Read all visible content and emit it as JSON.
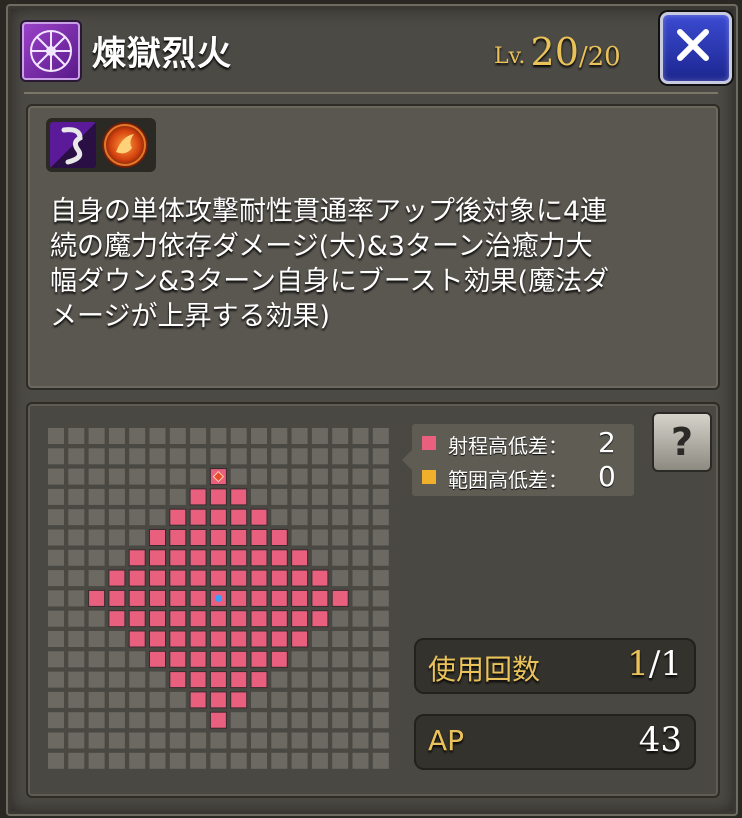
{
  "header": {
    "skill_icon": "magic-wheel-icon",
    "title": "煉獄烈火",
    "level_prefix": "Lv.",
    "level_current": "20",
    "level_separator": "/",
    "level_max": "20",
    "close_icon": "close-x-icon"
  },
  "description": {
    "effect_icons": [
      "dark-slash-icon",
      "fire-orb-icon"
    ],
    "lines": [
      "自身の単体攻撃耐性貫通率アップ後対象に4連",
      "続の魔力依存ダメージ(大)&3ターン治癒力大",
      "幅ダウン&3ターン自身にブースト効果(魔法ダ",
      "メージが上昇する効果)"
    ]
  },
  "range": {
    "grid_size": 17,
    "center": [
      8,
      8
    ],
    "marker": [
      8,
      2
    ],
    "legend": [
      {
        "label": "射程高低差：",
        "value": "2",
        "color": "#e8607e"
      },
      {
        "label": "範囲高低差：",
        "value": "0",
        "color": "#f0b02c"
      }
    ],
    "help_label": "?"
  },
  "stats": {
    "uses_label": "使用回数",
    "uses_current": "1",
    "uses_separator": "/",
    "uses_max": "1",
    "ap_label": "AP",
    "ap_value": "43"
  },
  "colors": {
    "gold": "#e9c25a",
    "range_tile": "#e8607e",
    "grid_tile": "#6b6962",
    "close_blue": "#2a38b8"
  }
}
